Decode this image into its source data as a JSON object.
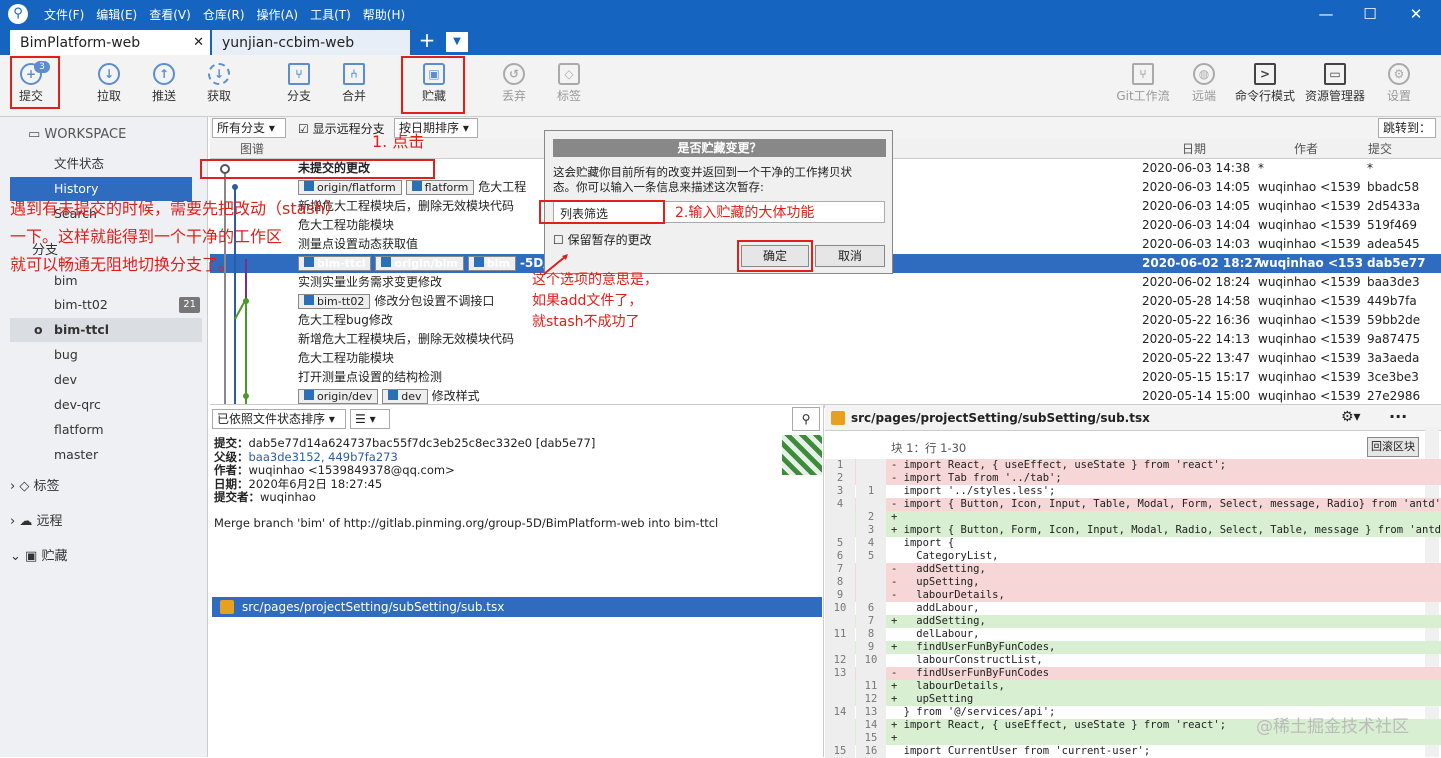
{
  "title_menu": [
    "文件(F)",
    "编辑(E)",
    "查看(V)",
    "仓库(R)",
    "操作(A)",
    "工具(T)",
    "帮助(H)"
  ],
  "tabs": [
    "BimPlatform-web",
    "yunjian-ccbim-web"
  ],
  "toolbar": {
    "commit": "提交",
    "commit_badge": "3",
    "pull": "拉取",
    "push": "推送",
    "fetch": "获取",
    "branch": "分支",
    "merge": "合并",
    "stash": "贮藏",
    "discard": "丢弃",
    "tag": "标签",
    "gitflow": "Git工作流",
    "remote": "远端",
    "terminal": "命令行模式",
    "explorer": "资源管理器",
    "settings": "设置"
  },
  "sidebar": {
    "workspace": "WORKSPACE",
    "items": [
      "文件状态",
      "History",
      "Search"
    ],
    "branches_title": "分支",
    "branches": [
      "bim",
      "bim-tt02",
      "bim-ttcl",
      "bug",
      "dev",
      "dev-qrc",
      "flatform",
      "master"
    ],
    "bim_tt02_count": "21",
    "tags": "标签",
    "remotes": "远程",
    "stashes": "贮藏"
  },
  "filter": {
    "all_branches": "所有分支",
    "show_remote": "显示远程分支",
    "sort": "按日期排序",
    "jump": "跳转到："
  },
  "columns": {
    "graph": "图谱",
    "date": "日期",
    "author": "作者",
    "commit": "提交"
  },
  "commits": [
    {
      "msg": "未提交的更改",
      "date": "2020-06-03 14:38",
      "author": "*",
      "hash": "*"
    },
    {
      "tags": [
        "origin/flatform",
        "flatform"
      ],
      "msg": "危大工程",
      "date": "2020-06-03 14:05",
      "author": "wuqinhao <1539",
      "hash": "bbadc58"
    },
    {
      "msg": "新增危大工程模块后，删除无效模块代码",
      "date": "2020-06-03 14:05",
      "author": "wuqinhao <1539",
      "hash": "2d5433a"
    },
    {
      "msg": "危大工程功能模块",
      "date": "2020-06-03 14:04",
      "author": "wuqinhao <1539",
      "hash": "519f469"
    },
    {
      "msg": "测量点设置动态获取值",
      "date": "2020-06-03 14:03",
      "author": "wuqinhao <1539",
      "hash": "adea545"
    },
    {
      "tags": [
        "bim-ttcl",
        "origin/bim",
        "bim"
      ],
      "msg": "-5D/BimPlatform-web into bim-ttcl",
      "date": "2020-06-02 18:27",
      "author": "wuqinhao <1539",
      "hash": "dab5e77"
    },
    {
      "msg": "实测实量业务需求变更修改",
      "date": "2020-06-02 18:24",
      "author": "wuqinhao <1539",
      "hash": "baa3de3"
    },
    {
      "tags": [
        "bim-tt02"
      ],
      "msg": "修改分包设置不调接口",
      "date": "2020-05-28 14:58",
      "author": "wuqinhao <1539",
      "hash": "449b7fa"
    },
    {
      "msg": "危大工程bug修改",
      "date": "2020-05-22 16:36",
      "author": "wuqinhao <1539",
      "hash": "59bb2de"
    },
    {
      "msg": "新增危大工程模块后，删除无效模块代码",
      "date": "2020-05-22 14:13",
      "author": "wuqinhao <1539",
      "hash": "9a87475"
    },
    {
      "msg": "危大工程功能模块",
      "date": "2020-05-22 13:47",
      "author": "wuqinhao <1539",
      "hash": "3a3aeda"
    },
    {
      "msg": "打开测量点设置的结构检测",
      "date": "2020-05-15 15:17",
      "author": "wuqinhao <1539",
      "hash": "3ce3be3"
    },
    {
      "tags": [
        "origin/dev",
        "dev"
      ],
      "msg": "修改样式",
      "date": "2020-05-14 15:00",
      "author": "wuqinhao <1539",
      "hash": "27e2986"
    }
  ],
  "detail": {
    "sort": "已依照文件状态排序",
    "commit_label": "提交：",
    "commit_val": "dab5e77d14a624737bac55f7dc3eb25c8ec332e0 [dab5e77]",
    "parent_label": "父级：",
    "parent_val": "baa3de3152, 449b7fa273",
    "author_label": "作者：",
    "author_val": "wuqinhao <1539849378@qq.com>",
    "date_label": "日期：",
    "date_val": "2020年6月2日 18:27:45",
    "committer_label": "提交者：",
    "committer_val": "wuqinhao",
    "message": "Merge branch 'bim' of http://gitlab.pinming.org/group-5D/BimPlatform-web into bim-ttcl",
    "file": "src/pages/projectSetting/subSetting/sub.tsx"
  },
  "diff": {
    "file": "src/pages/projectSetting/subSetting/sub.tsx",
    "hunk": "块 1：行 1-30",
    "revert": "回滚区块",
    "lines": [
      {
        "t": "del",
        "a": "1",
        "b": "",
        "c": "- import React, { useEffect, useState } from 'react';"
      },
      {
        "t": "del",
        "a": "2",
        "b": "",
        "c": "- import Tab from '../tab';"
      },
      {
        "t": "ctx",
        "a": "3",
        "b": "1",
        "c": "  import '../styles.less';"
      },
      {
        "t": "del",
        "a": "4",
        "b": "",
        "c": "- import { Button, Icon, Input, Table, Modal, Form, Select, message, Radio} from 'antd'"
      },
      {
        "t": "add",
        "a": "",
        "b": "2",
        "c": "+"
      },
      {
        "t": "add",
        "a": "",
        "b": "3",
        "c": "+ import { Button, Form, Icon, Input, Modal, Radio, Select, Table, message } from 'antd"
      },
      {
        "t": "ctx",
        "a": "5",
        "b": "4",
        "c": "  import {"
      },
      {
        "t": "ctx",
        "a": "6",
        "b": "5",
        "c": "    CategoryList,"
      },
      {
        "t": "del",
        "a": "7",
        "b": "",
        "c": "-   addSetting,"
      },
      {
        "t": "del",
        "a": "8",
        "b": "",
        "c": "-   upSetting,"
      },
      {
        "t": "del",
        "a": "9",
        "b": "",
        "c": "-   labourDetails,"
      },
      {
        "t": "ctx",
        "a": "10",
        "b": "6",
        "c": "    addLabour,"
      },
      {
        "t": "add",
        "a": "",
        "b": "7",
        "c": "+   addSetting,"
      },
      {
        "t": "ctx",
        "a": "11",
        "b": "8",
        "c": "    delLabour,"
      },
      {
        "t": "add",
        "a": "",
        "b": "9",
        "c": "+   findUserFunByFunCodes,"
      },
      {
        "t": "ctx",
        "a": "12",
        "b": "10",
        "c": "    labourConstructList,"
      },
      {
        "t": "del",
        "a": "13",
        "b": "",
        "c": "-   findUserFunByFunCodes"
      },
      {
        "t": "add",
        "a": "",
        "b": "11",
        "c": "+   labourDetails,"
      },
      {
        "t": "add",
        "a": "",
        "b": "12",
        "c": "+   upSetting"
      },
      {
        "t": "ctx",
        "a": "14",
        "b": "13",
        "c": "  } from '@/services/api';"
      },
      {
        "t": "add",
        "a": "",
        "b": "14",
        "c": "+ import React, { useEffect, useState } from 'react';"
      },
      {
        "t": "add",
        "a": "",
        "b": "15",
        "c": "+"
      },
      {
        "t": "ctx",
        "a": "15",
        "b": "16",
        "c": "  import CurrentUser from 'current-user';"
      }
    ]
  },
  "dialog": {
    "title": "是否贮藏变更？",
    "desc1": "这会贮藏你目前所有的改变并返回到一个干净的工作拷贝状",
    "desc2": "态。你可以输入一条信息来描述这次暂存:",
    "input": "列表筛选",
    "keep": "保留暂存的更改",
    "ok": "确定",
    "cancel": "取消"
  },
  "annotations": {
    "a1": "1. 点击",
    "a2": "2.输入贮藏的大体功能",
    "left1": "遇到有未提交的时候，需要先把改动（stash）",
    "left2": "一下。这样就能得到一个干净的工作区",
    "left3": "就可以畅通无阻地切换分支了。",
    "opt1": "这个选项的意思是，",
    "opt2": "如果add文件了，",
    "opt3": "就stash不成功了"
  },
  "watermark": "@稀土掘金技术社区"
}
